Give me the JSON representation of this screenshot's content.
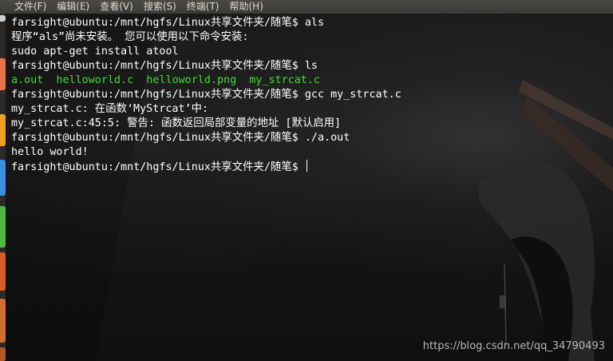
{
  "menu": {
    "items": [
      {
        "label": "文件(F)"
      },
      {
        "label": "编辑(E)"
      },
      {
        "label": "查看(V)"
      },
      {
        "label": "搜索(S)"
      },
      {
        "label": "终端(T)"
      },
      {
        "label": "帮助(H)"
      }
    ]
  },
  "terminal": {
    "prompt": "farsight@ubuntu:/mnt/hgfs/Linux共享文件夹/随笔$ ",
    "lines": {
      "l1_cmd": "als",
      "l2": "程序“als”尚未安装。 您可以使用以下命令安装:",
      "l3": "sudo apt-get install atool",
      "l4_cmd": "ls",
      "l5_files": [
        "a.out",
        "helloworld.c",
        "helloworld.png",
        "my_strcat.c"
      ],
      "l6_cmd": "gcc my_strcat.c",
      "l7": "my_strcat.c: 在函数‘MyStrcat’中:",
      "l8": "my_strcat.c:45:5: 警告: 函数返回局部变量的地址 [默认启用]",
      "l9_cmd": "./a.out",
      "l10": "hello world!",
      "l11_cmd": ""
    }
  },
  "watermark": "https://blog.csdn.net/qq_34790493",
  "colors": {
    "text": "#ffffff",
    "ls_file": "#44dd33",
    "menubar": "#3c3b37",
    "menu_text": "#dfdbd2"
  }
}
